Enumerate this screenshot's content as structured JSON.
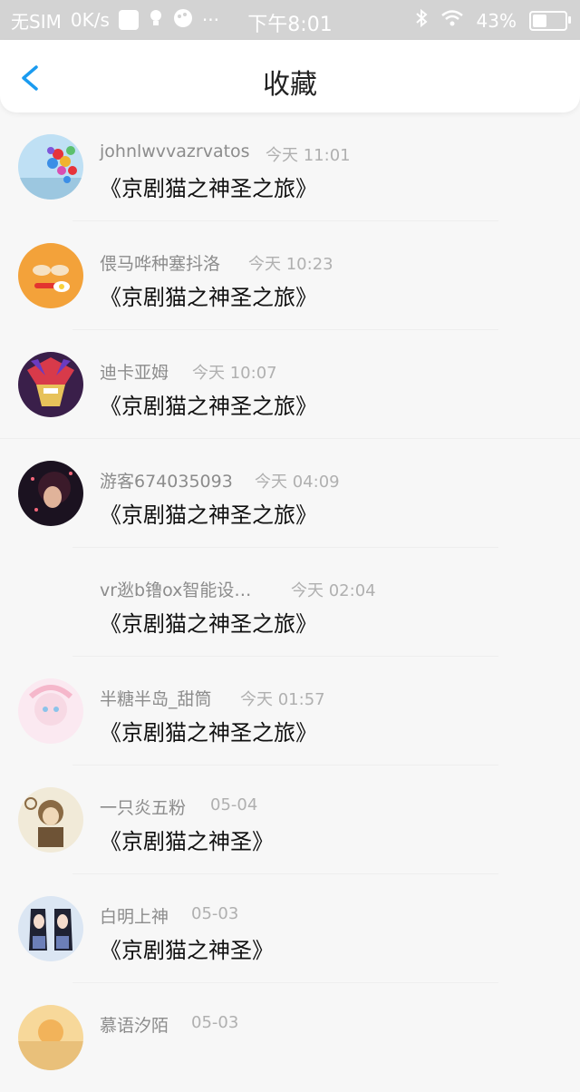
{
  "status_bar": {
    "carrier": "无SIM",
    "speed": "0K/s",
    "more": "···",
    "time": "下午8:01",
    "battery": "43%"
  },
  "header": {
    "title": "收藏"
  },
  "items": [
    {
      "name": "johnlwvvazrvatos",
      "time": "今天 11:01",
      "book": "《京剧猫之神圣之旅》",
      "avatar": "balloons-avatar"
    },
    {
      "name": "偎马哗种塞抖洛",
      "time": "今天 10:23",
      "book": "《京剧猫之神圣之旅》",
      "avatar": "food-avatar"
    },
    {
      "name": "迪卡亚姆",
      "time": "今天 10:07",
      "book": "《京剧猫之神圣之旅》",
      "avatar": "anime-warrior-avatar"
    },
    {
      "name": "游客674035093",
      "time": "今天 04:09",
      "book": "《京剧猫之神圣之旅》",
      "avatar": "dark-portrait-avatar"
    },
    {
      "name": "vr逖b镥ox智能设…",
      "time": "今天 02:04",
      "book": "《京剧猫之神圣之旅》",
      "avatar": "none"
    },
    {
      "name": "半糖半岛_甜筒",
      "time": "今天 01:57",
      "book": "《京剧猫之神圣之旅》",
      "avatar": "pink-anime-avatar"
    },
    {
      "name": "一只炎五粉",
      "time": "05-04",
      "book": "《京剧猫之神圣》",
      "avatar": "sepia-anime-avatar"
    },
    {
      "name": "白明上神",
      "time": "05-03",
      "book": "《京剧猫之神圣》",
      "avatar": "anime-girls-avatar"
    },
    {
      "name": "慕语汐陌",
      "time": "05-03",
      "book": "",
      "avatar": "sunset-avatar"
    }
  ]
}
